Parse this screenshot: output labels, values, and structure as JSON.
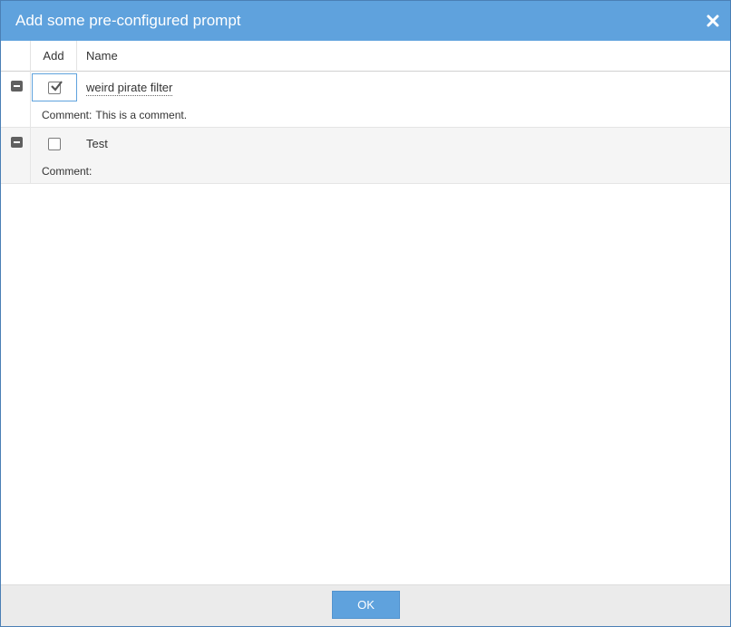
{
  "dialog": {
    "title": "Add some pre-configured prompt",
    "close_icon": "close-icon"
  },
  "grid": {
    "columns": {
      "add": "Add",
      "name": "Name"
    },
    "rows": [
      {
        "checked": true,
        "name": "weird pirate filter",
        "comment_label": "Comment:",
        "comment_value": "This is a comment."
      },
      {
        "checked": false,
        "name": "Test",
        "comment_label": "Comment:",
        "comment_value": ""
      }
    ]
  },
  "footer": {
    "ok_label": "OK"
  },
  "colors": {
    "accent": "#5fa2dd",
    "footer_bg": "#ebebeb",
    "alt_row": "#f5f5f5"
  }
}
